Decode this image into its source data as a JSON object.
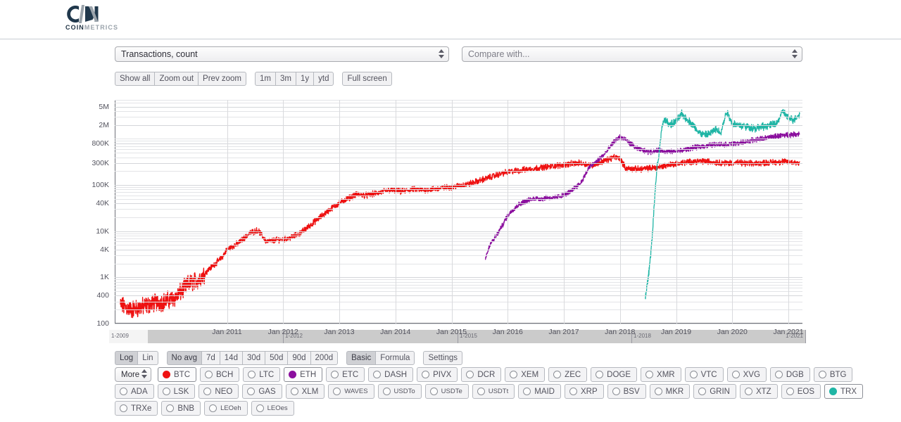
{
  "brand": {
    "name_bold": "COIN",
    "name_light": "METRICS"
  },
  "selects": {
    "metric": {
      "value": "Transactions, count"
    },
    "compare": {
      "value": "Compare with..."
    }
  },
  "zoom_bar": {
    "group1": [
      "Show all",
      "Zoom out",
      "Prev zoom"
    ],
    "group2": [
      "1m",
      "3m",
      "1y",
      "ytd"
    ],
    "group3": [
      "Full screen"
    ]
  },
  "options_bar": {
    "scale": {
      "options": [
        "Log",
        "Lin"
      ],
      "active": "Log"
    },
    "average": {
      "options": [
        "No avg",
        "7d",
        "14d",
        "30d",
        "50d",
        "90d",
        "200d"
      ],
      "active": "No avg"
    },
    "mode": {
      "options": [
        "Basic",
        "Formula"
      ],
      "active": "Basic"
    },
    "settings": "Settings"
  },
  "coin_selector": {
    "more_label": "More",
    "rows": [
      [
        {
          "ticker": "BTC",
          "selected": true,
          "color": "#ee1111"
        },
        {
          "ticker": "BCH",
          "selected": false
        },
        {
          "ticker": "LTC",
          "selected": false
        },
        {
          "ticker": "ETH",
          "selected": true,
          "color": "#8b0f9e"
        },
        {
          "ticker": "ETC",
          "selected": false
        },
        {
          "ticker": "DASH",
          "selected": false
        },
        {
          "ticker": "PIVX",
          "selected": false
        },
        {
          "ticker": "DCR",
          "selected": false
        },
        {
          "ticker": "XEM",
          "selected": false
        },
        {
          "ticker": "ZEC",
          "selected": false
        },
        {
          "ticker": "DOGE",
          "selected": false
        },
        {
          "ticker": "XMR",
          "selected": false
        },
        {
          "ticker": "VTC",
          "selected": false
        },
        {
          "ticker": "XVG",
          "selected": false
        },
        {
          "ticker": "DGB",
          "selected": false
        },
        {
          "ticker": "BTG",
          "selected": false
        }
      ],
      [
        {
          "ticker": "ADA",
          "selected": false
        },
        {
          "ticker": "LSK",
          "selected": false
        },
        {
          "ticker": "NEO",
          "selected": false
        },
        {
          "ticker": "GAS",
          "selected": false
        },
        {
          "ticker": "XLM",
          "selected": false
        },
        {
          "ticker": "WAVES",
          "selected": false,
          "small": true
        },
        {
          "ticker": "USDTo",
          "selected": false,
          "small": true
        },
        {
          "ticker": "USDTe",
          "selected": false,
          "small": true
        },
        {
          "ticker": "USDTt",
          "selected": false,
          "small": true
        },
        {
          "ticker": "MAID",
          "selected": false
        },
        {
          "ticker": "XRP",
          "selected": false
        },
        {
          "ticker": "BSV",
          "selected": false
        },
        {
          "ticker": "MKR",
          "selected": false
        },
        {
          "ticker": "GRIN",
          "selected": false
        },
        {
          "ticker": "XTZ",
          "selected": false
        },
        {
          "ticker": "EOS",
          "selected": false
        },
        {
          "ticker": "TRX",
          "selected": true,
          "color": "#1fb5a5"
        }
      ],
      [
        {
          "ticker": "TRXe",
          "selected": false
        },
        {
          "ticker": "BNB",
          "selected": false
        },
        {
          "ticker": "LEOeh",
          "selected": false,
          "small": true
        },
        {
          "ticker": "LEOes",
          "selected": false,
          "small": true
        }
      ]
    ]
  },
  "navigator": {
    "labels": [
      "1-2009",
      "1-2012",
      "1-2015",
      "1-2018",
      "1-2021"
    ],
    "selection_start": "1-2010",
    "selection_end": "1-2021"
  },
  "chart_data": {
    "type": "line",
    "title": "Transactions, count",
    "xlabel": "",
    "ylabel": "Transactions, count",
    "yscale": "log",
    "ylim": [
      100,
      7000000
    ],
    "grid": true,
    "legend": "none",
    "ytick_labels": [
      "5M",
      "2M",
      "800K",
      "300K",
      "100K",
      "40K",
      "10K",
      "4K",
      "1K",
      "400",
      "100"
    ],
    "ytick_values": [
      5000000,
      2000000,
      800000,
      300000,
      100000,
      40000,
      10000,
      4000,
      1000,
      400,
      100
    ],
    "xtick_labels": [
      "Jan 2011",
      "Jan 2012",
      "Jan 2013",
      "Jan 2014",
      "Jan 2015",
      "Jan 2016",
      "Jan 2017",
      "Jan 2018",
      "Jan 2019",
      "Jan 2020",
      "Jan 2021"
    ],
    "xtick_values": [
      2011.0,
      2012.0,
      2013.0,
      2014.0,
      2015.0,
      2016.0,
      2017.0,
      2018.0,
      2019.0,
      2020.0,
      2021.0
    ],
    "xlim": [
      2009.0,
      2021.25
    ],
    "series": [
      {
        "name": "BTC",
        "color": "#ee1111",
        "x": [
          2009.1,
          2009.3,
          2009.5,
          2009.7,
          2009.9,
          2010.1,
          2010.3,
          2010.5,
          2010.7,
          2010.9,
          2011.0,
          2011.2,
          2011.4,
          2011.55,
          2011.7,
          2011.9,
          2012.1,
          2012.3,
          2012.5,
          2012.7,
          2012.9,
          2013.1,
          2013.3,
          2013.5,
          2013.7,
          2013.9,
          2014.1,
          2014.3,
          2014.5,
          2014.7,
          2014.9,
          2015.1,
          2015.3,
          2015.5,
          2015.7,
          2015.9,
          2016.1,
          2016.3,
          2016.5,
          2016.7,
          2016.9,
          2017.1,
          2017.3,
          2017.5,
          2017.7,
          2017.9,
          2018.0,
          2018.1,
          2018.3,
          2018.5,
          2018.7,
          2018.9,
          2019.1,
          2019.3,
          2019.5,
          2019.7,
          2019.9,
          2020.1,
          2020.3,
          2020.5,
          2020.7,
          2020.9,
          2021.1,
          2021.2
        ],
        "y": [
          250,
          200,
          230,
          280,
          300,
          380,
          700,
          900,
          1600,
          2600,
          4000,
          5500,
          9000,
          10500,
          6000,
          6500,
          7000,
          9000,
          14000,
          22000,
          34000,
          48000,
          62000,
          60000,
          68000,
          78000,
          72000,
          80000,
          78000,
          82000,
          88000,
          95000,
          105000,
          125000,
          150000,
          180000,
          200000,
          215000,
          230000,
          250000,
          265000,
          285000,
          300000,
          265000,
          330000,
          400000,
          380000,
          230000,
          220000,
          230000,
          245000,
          280000,
          300000,
          325000,
          330000,
          310000,
          300000,
          305000,
          290000,
          300000,
          310000,
          320000,
          310000,
          305000
        ]
      },
      {
        "name": "ETH",
        "color": "#8b0f9e",
        "x": [
          2015.6,
          2015.7,
          2015.8,
          2015.9,
          2016.0,
          2016.1,
          2016.2,
          2016.3,
          2016.4,
          2016.5,
          2016.6,
          2016.7,
          2016.8,
          2016.9,
          2017.0,
          2017.1,
          2017.2,
          2017.3,
          2017.45,
          2017.6,
          2017.75,
          2017.9,
          2018.0,
          2018.1,
          2018.3,
          2018.5,
          2018.7,
          2018.9,
          2019.1,
          2019.3,
          2019.5,
          2019.7,
          2019.9,
          2020.1,
          2020.3,
          2020.5,
          2020.7,
          2020.9,
          2021.1,
          2021.2
        ],
        "y": [
          2600,
          5500,
          8000,
          13000,
          22000,
          30000,
          38000,
          44000,
          48000,
          52000,
          50000,
          54000,
          52000,
          56000,
          60000,
          70000,
          90000,
          110000,
          240000,
          340000,
          500000,
          900000,
          1100000,
          950000,
          620000,
          520000,
          560000,
          520000,
          560000,
          640000,
          700000,
          760000,
          760000,
          800000,
          900000,
          1000000,
          1100000,
          1200000,
          1250000,
          1300000
        ]
      },
      {
        "name": "TRX",
        "color": "#1fb5a5",
        "x": [
          2018.45,
          2018.5,
          2018.54,
          2018.58,
          2018.62,
          2018.66,
          2018.7,
          2018.75,
          2018.8,
          2018.9,
          2019.0,
          2019.1,
          2019.2,
          2019.3,
          2019.4,
          2019.5,
          2019.6,
          2019.7,
          2019.8,
          2019.9,
          2020.0,
          2020.1,
          2020.2,
          2020.3,
          2020.4,
          2020.5,
          2020.6,
          2020.7,
          2020.8,
          2020.9,
          2021.0,
          2021.1,
          2021.2
        ],
        "y": [
          380,
          900,
          2500,
          9000,
          60000,
          250000,
          500000,
          2000000,
          2600000,
          2000000,
          2400000,
          3500000,
          2600000,
          2000000,
          1400000,
          1200000,
          1300000,
          1600000,
          1400000,
          4000000,
          2200000,
          2000000,
          1900000,
          1800000,
          1700000,
          1800000,
          1900000,
          2000000,
          2200000,
          4000000,
          2800000,
          2600000,
          3500000
        ]
      }
    ]
  }
}
